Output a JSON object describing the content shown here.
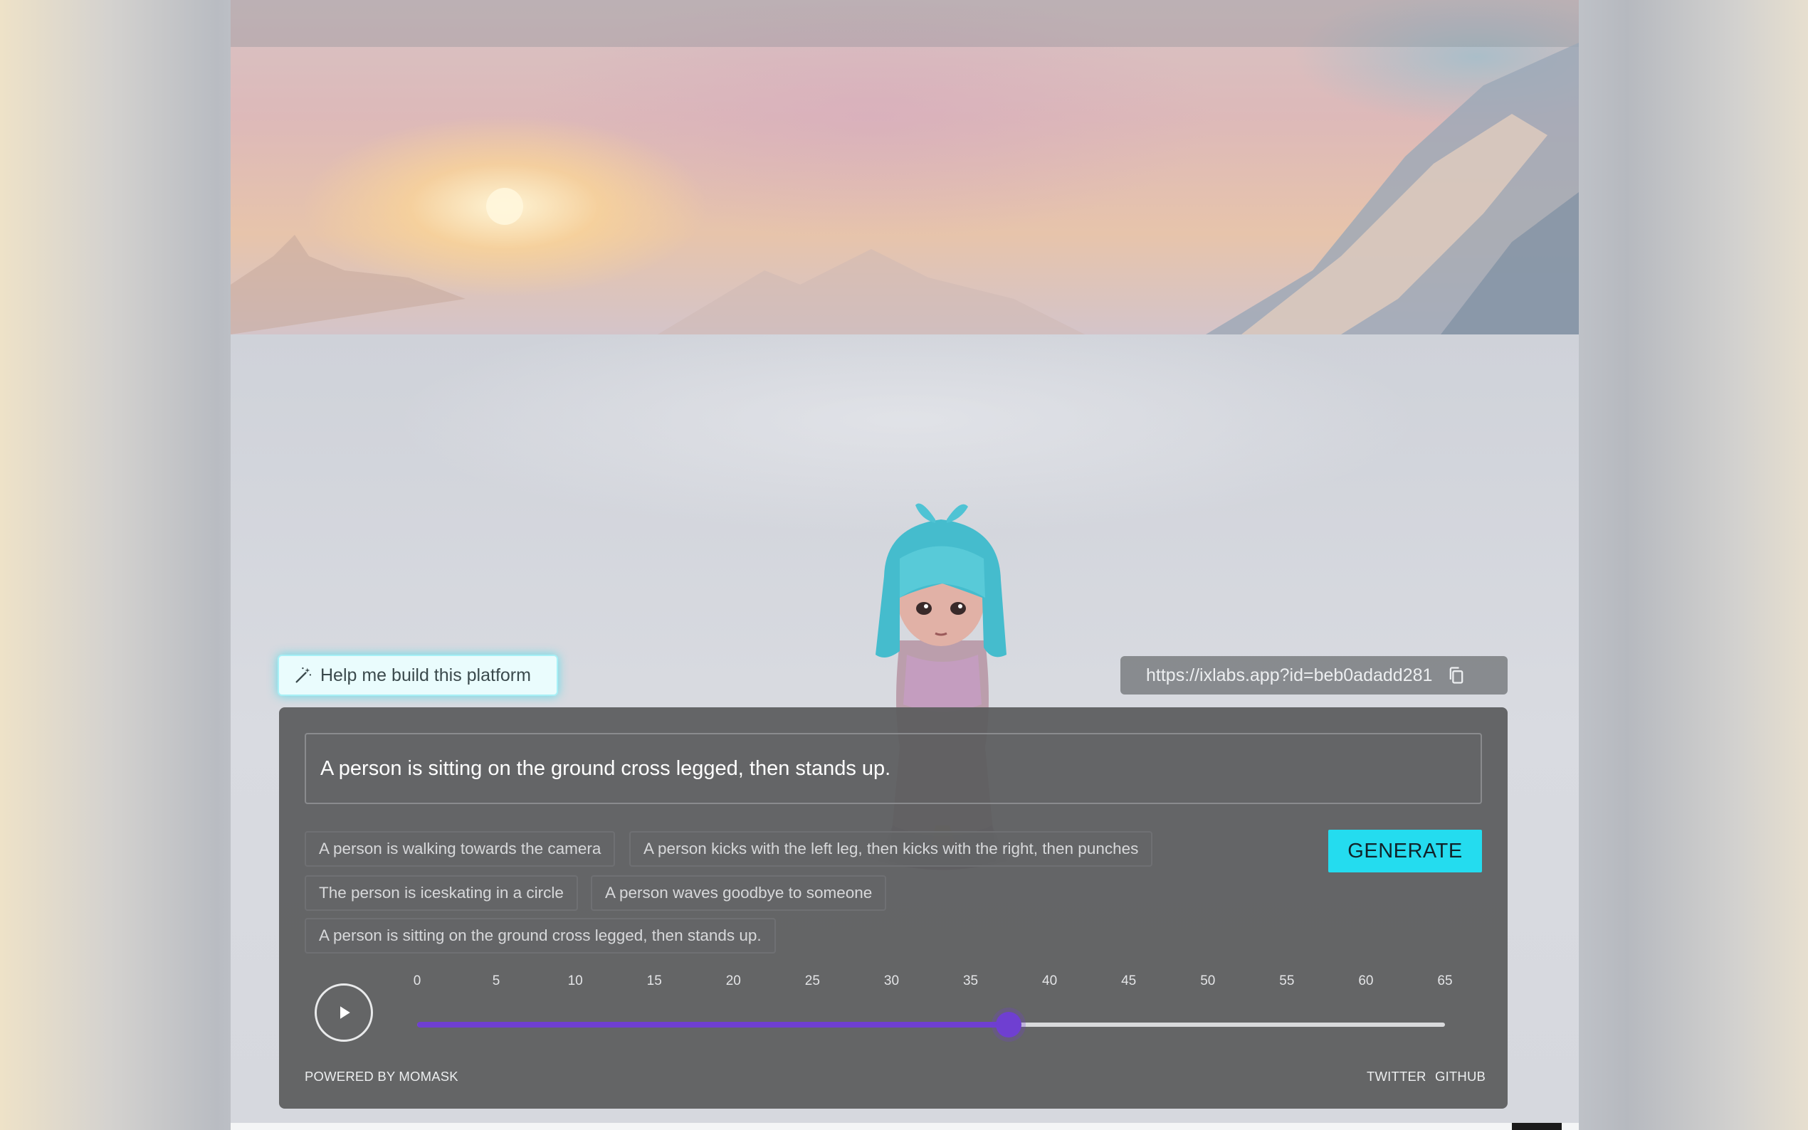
{
  "help_button": {
    "label": "Help me build this platform",
    "icon": "magic-wand-icon"
  },
  "share": {
    "url": "https://ixlabs.app?id=beb0adadd281",
    "copy_icon": "copy-icon"
  },
  "prompt": {
    "value": "A person is sitting on the ground cross legged, then stands up."
  },
  "suggestions": [
    "A person is walking towards the camera",
    "A person kicks with the left leg, then kicks with the right, then punches",
    "The person is iceskating in a circle",
    "A person waves goodbye to someone",
    "A person is sitting on the ground cross legged, then stands up."
  ],
  "generate_label": "GENERATE",
  "timeline": {
    "ticks": [
      "0",
      "5",
      "10",
      "15",
      "20",
      "25",
      "30",
      "35",
      "40",
      "45",
      "50",
      "55",
      "60",
      "65"
    ],
    "min": 0,
    "max": 65,
    "value": 37.4
  },
  "footer": {
    "powered_by": "POWERED BY MOMASK",
    "twitter": "TWITTER",
    "github": "GITHUB"
  },
  "colors": {
    "accent": "#24dcef",
    "slider": "#6f3fd1",
    "panel": "#5c5d5f"
  }
}
